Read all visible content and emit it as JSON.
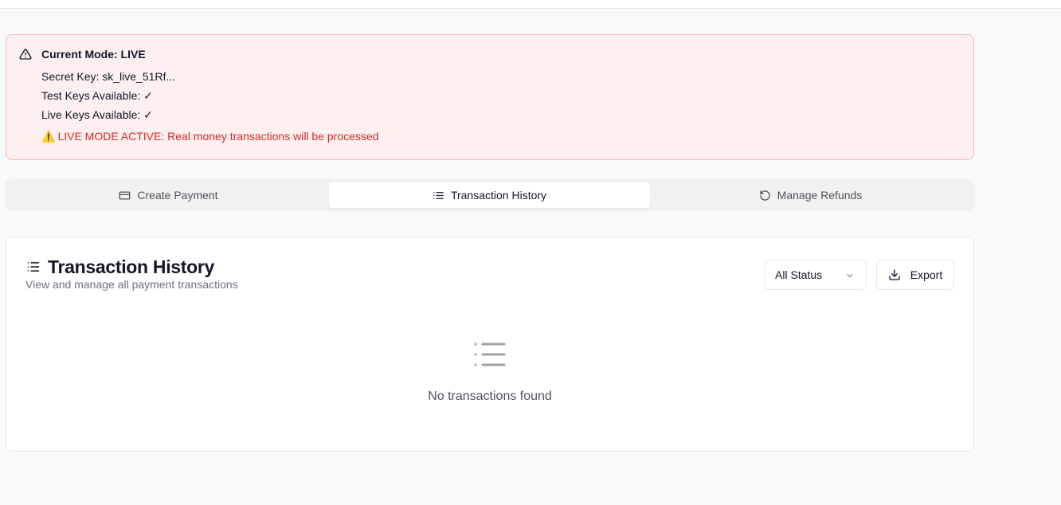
{
  "alert": {
    "title": "Current Mode: LIVE",
    "secret_key": "Secret Key: sk_live_51Rf...",
    "test_keys": "Test Keys Available: ✓",
    "live_keys": "Live Keys Available: ✓",
    "warning_emoji": "⚠️",
    "warning_text": "LIVE MODE ACTIVE: Real money transactions will be processed",
    "colors": {
      "background": "#fef0f0",
      "border": "#fbb8b8",
      "warning": "#dc2626"
    }
  },
  "tabs": [
    {
      "label": "Create Payment",
      "icon": "credit-card-icon",
      "active": false
    },
    {
      "label": "Transaction History",
      "icon": "list-icon",
      "active": true
    },
    {
      "label": "Manage Refunds",
      "icon": "rotate-ccw-icon",
      "active": false
    }
  ],
  "card": {
    "title": "Transaction History",
    "subtitle": "View and manage all payment transactions",
    "status_filter": {
      "selected": "All Status"
    },
    "export_label": "Export",
    "empty_state": "No transactions found"
  }
}
